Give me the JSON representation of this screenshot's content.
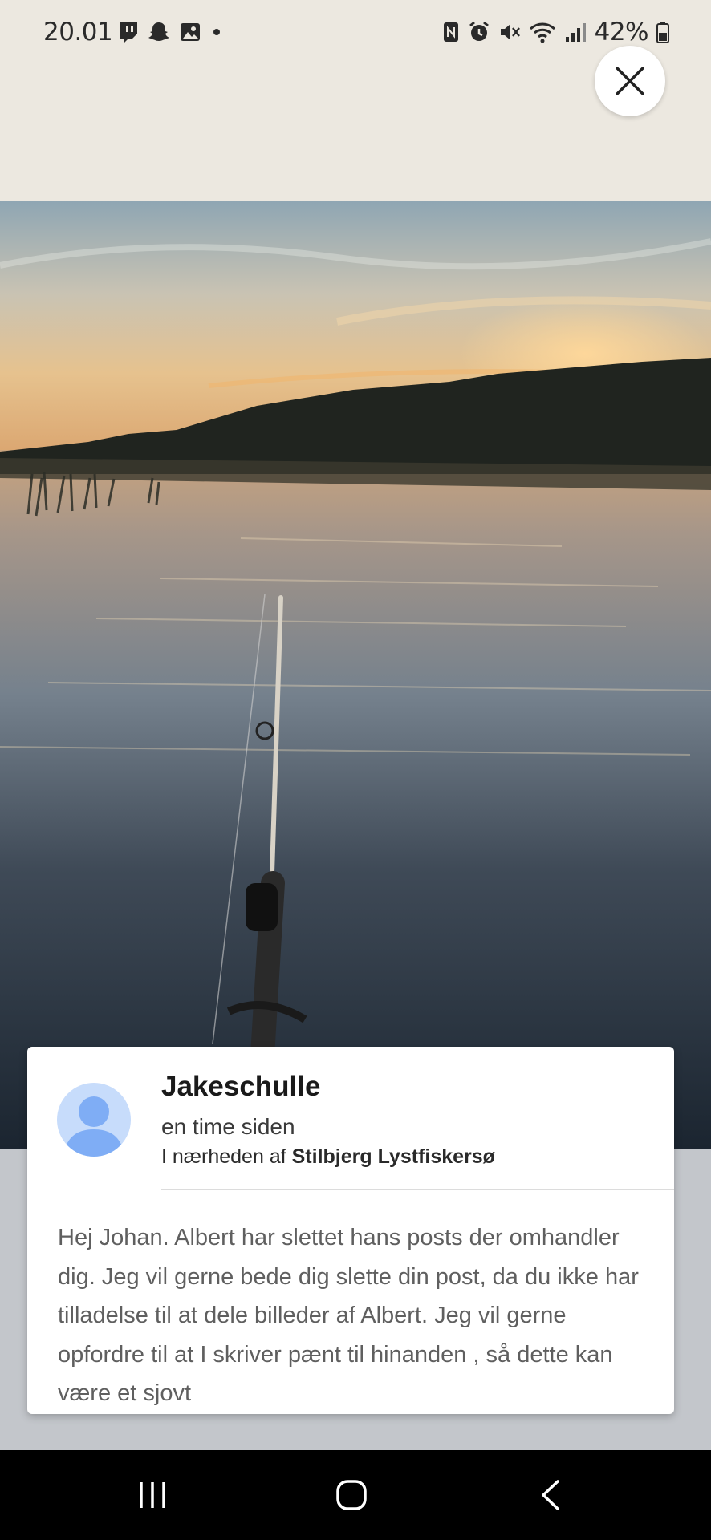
{
  "status_bar": {
    "time": "20.01",
    "left_icons": [
      "twitch-icon",
      "snapchat-icon",
      "gallery-icon",
      "dot-icon"
    ],
    "right_icons": [
      "nfc-icon",
      "alarm-icon",
      "mute-icon",
      "wifi-icon",
      "signal-icon",
      "battery-icon"
    ],
    "battery": "42%"
  },
  "post": {
    "username": "Jakeschulle",
    "time_ago": "en time siden",
    "location_prefix": "I nærheden af",
    "location_name": "Stilbjerg Lystfiskersø",
    "text": "Hej Johan. Albert har slettet hans posts der omhandler dig. Jeg vil gerne bede dig slette din post, da du ikke har tilladelse til at dele billeder af Albert. Jeg vil gerne opfordre til at I skriver pænt til hinanden , så dette kan være et sjovt"
  },
  "photo": {
    "subject": "sunset lake with fishing rod"
  },
  "nav": [
    "recent-apps-icon",
    "home-icon",
    "back-icon"
  ],
  "colors": {
    "card_bg": "#ffffff",
    "avatar_bg": "#c7dcfb",
    "avatar_fg": "#7fadf5",
    "lower_bg": "#c3c6cb"
  }
}
